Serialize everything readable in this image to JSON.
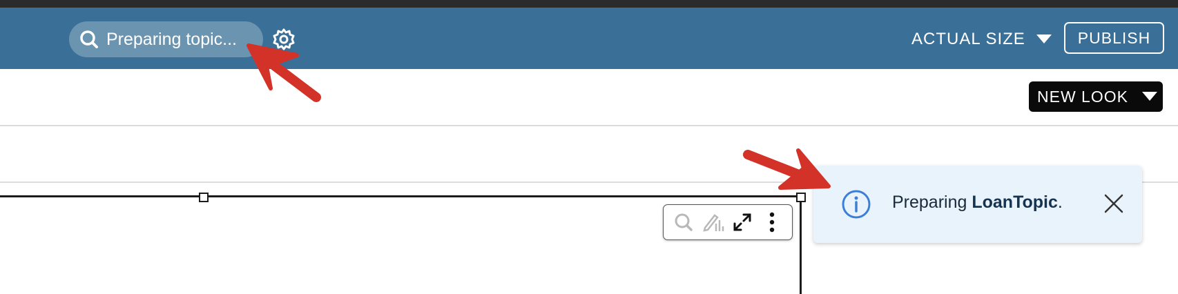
{
  "header": {
    "search_text": "Preparing topic...",
    "actual_size_label": "ACTUAL SIZE",
    "publish_label": "PUBLISH",
    "bg_color": "#3a7097"
  },
  "toolbar": {
    "new_look_label": "NEW LOOK"
  },
  "visual_menu": {
    "icons": [
      "search-icon",
      "edit-chart-icon",
      "expand-icon",
      "more-vert-icon"
    ]
  },
  "toast": {
    "prefix": "Preparing ",
    "topic": "LoanTopic",
    "suffix": ".",
    "icon": "info-icon",
    "bg_color": "#e8f3fc"
  },
  "annotations": {
    "arrow_color": "#d33228"
  }
}
